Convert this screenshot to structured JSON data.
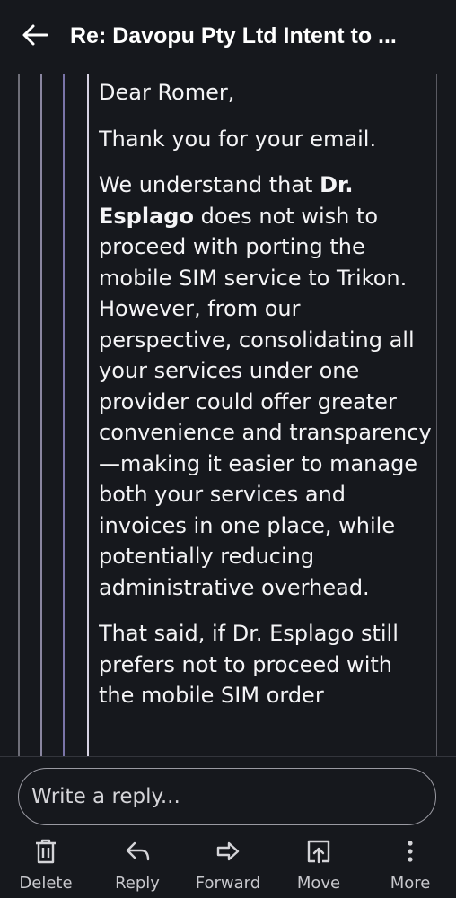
{
  "header": {
    "title": "Re: Davopu Pty Ltd Intent to ..."
  },
  "message": {
    "greeting": "Dear Romer,",
    "thanks": "Thank you for your email.",
    "p1_pre": "We understand that ",
    "p1_bold": "Dr. Esplago",
    "p1_post": " does not wish to proceed with porting the mobile SIM service to Trikon. However, from our perspective, consolidating all your services under one provider could offer greater convenience and transparency—making it easier to manage both your services and invoices in one place, while potentially reducing administrative overhead.",
    "p2": "That said, if Dr. Esplago still prefers not to proceed with the mobile SIM order"
  },
  "reply": {
    "placeholder": "Write a reply..."
  },
  "actions": [
    {
      "label": "Delete",
      "icon": "trash-icon"
    },
    {
      "label": "Reply",
      "icon": "reply-icon"
    },
    {
      "label": "Forward",
      "icon": "forward-icon"
    },
    {
      "label": "Move",
      "icon": "move-icon"
    },
    {
      "label": "More",
      "icon": "more-vertical-icon"
    }
  ]
}
